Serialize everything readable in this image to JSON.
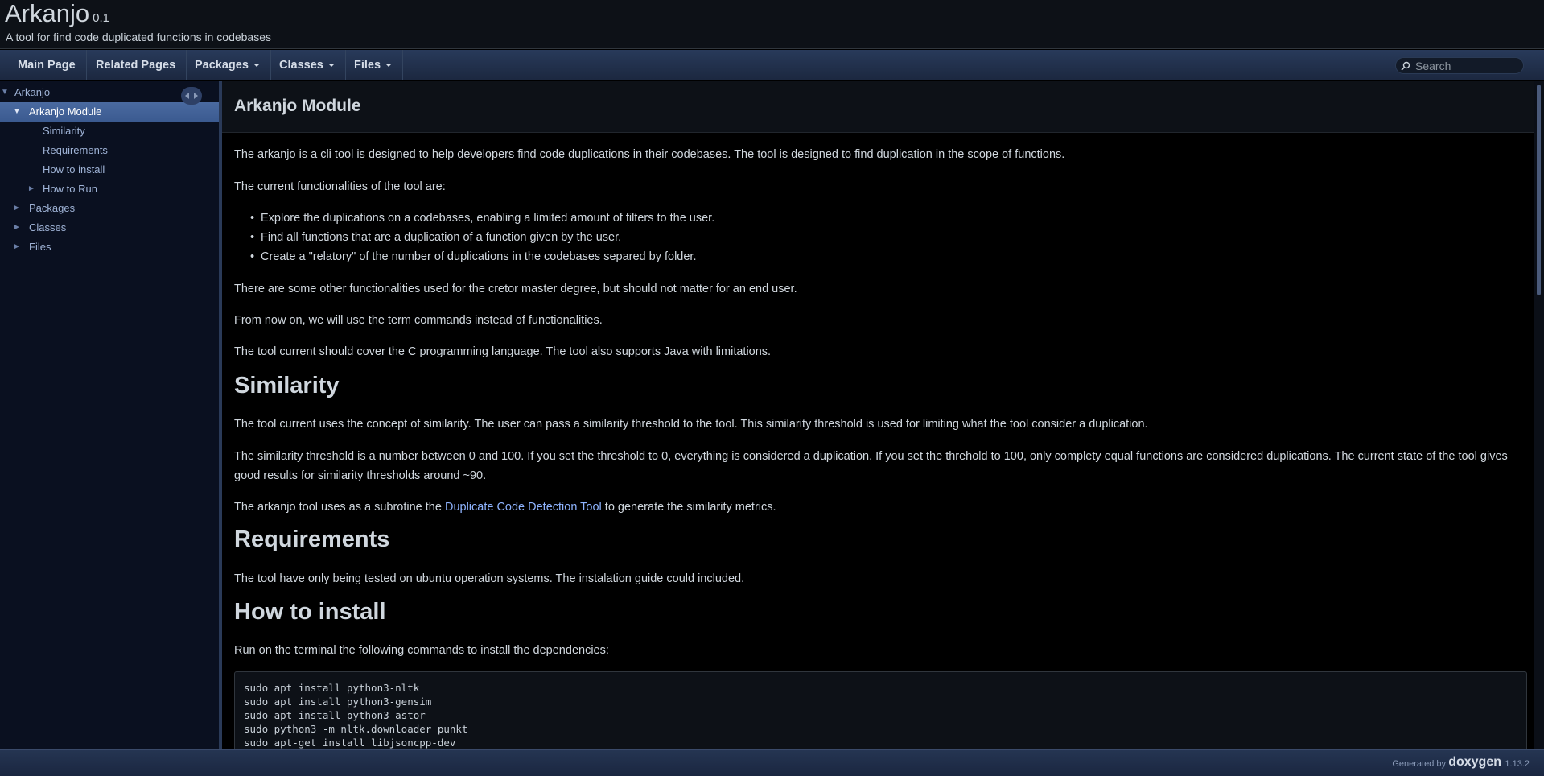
{
  "project": {
    "name": "Arkanjo",
    "version": "0.1",
    "brief": "A tool for find code duplicated functions in codebases"
  },
  "navbar": {
    "items": [
      {
        "label": "Main Page"
      },
      {
        "label": "Related Pages"
      },
      {
        "label": "Packages"
      },
      {
        "label": "Classes"
      },
      {
        "label": "Files"
      }
    ],
    "search_placeholder": "Search"
  },
  "sidebar": {
    "items": [
      {
        "label": "Arkanjo"
      },
      {
        "label": "Arkanjo Module"
      },
      {
        "label": "Similarity"
      },
      {
        "label": "Requirements"
      },
      {
        "label": "How to install"
      },
      {
        "label": "How to Run"
      },
      {
        "label": "Packages"
      },
      {
        "label": "Classes"
      },
      {
        "label": "Files"
      }
    ]
  },
  "page": {
    "title": "Arkanjo Module",
    "intro": "The arkanjo is a cli tool is designed to help developers find code duplications in their codebases. The tool is designed to find duplication in the scope of functions.",
    "func_intro": "The current functionalities of the tool are:",
    "bullets": [
      "Explore the duplications on a codebases, enabling a limited amount of filters to the user.",
      "Find all functions that are a duplication of a function given by the user.",
      "Create a \"relatory\" of the number of duplications in the codebases separed by folder."
    ],
    "other_func": "There are some other functionalities used for the cretor master degree, but should not matter for an end user.",
    "commands_term": "From now on, we will use the term commands instead of functionalities.",
    "languages": "The tool current should cover the C programming language. The tool also supports Java with limitations.",
    "similarity_heading": "Similarity",
    "similarity_p1": "The tool current uses the concept of similarity. The user can pass a similarity threshold to the tool. This similarity threshold is used for limiting what the tool consider a duplication.",
    "similarity_p2": "The similarity threshold is a number between 0 and 100. If you set the threshold to 0, everything is considered a duplication. If you set the threhold to 100, only complety equal functions are considered duplications. The current state of the tool gives good results for similarity thresholds around ~90.",
    "similarity_p3_before": "The arkanjo tool uses as a subrotine the ",
    "similarity_p3_link": "Duplicate Code Detection Tool",
    "similarity_p3_after": " to generate the similarity metrics.",
    "requirements_heading": "Requirements",
    "requirements_p": "The tool have only being tested on ubuntu operation systems. The instalation guide could included.",
    "install_heading": "How to install",
    "install_p": "Run on the terminal the following commands to install the dependencies:",
    "code_lines": [
      "sudo apt install python3-nltk",
      "sudo apt install python3-gensim",
      "sudo apt install python3-astor",
      "sudo python3 -m nltk.downloader punkt",
      "sudo apt-get install libjsoncpp-dev"
    ]
  },
  "footer": {
    "generated_by": "Generated by",
    "logo": "doxygen",
    "version": "1.13.2"
  }
}
